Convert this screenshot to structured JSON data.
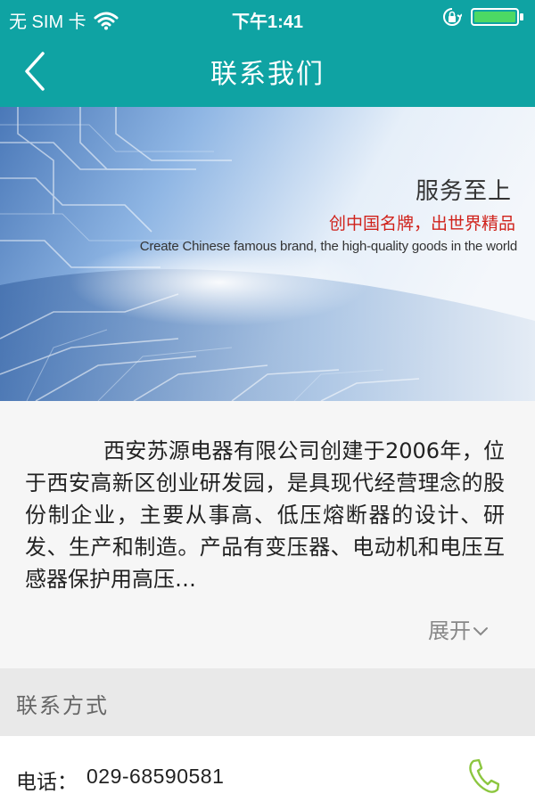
{
  "status_bar": {
    "carrier": "无 SIM 卡",
    "time": "下午1:41",
    "icons": [
      "wifi-icon",
      "orientation-lock-icon",
      "battery-icon"
    ]
  },
  "nav": {
    "back_icon": "chevron-left-icon",
    "title": "联系我们"
  },
  "banner": {
    "title": "服务至上",
    "slogan": "创中国名牌，出世界精品",
    "english": "Create Chinese famous brand, the high-quality goods in the world"
  },
  "intro": {
    "text": "西安苏源电器有限公司创建于2006年，位于西安高新区创业研发园，是具现代经营理念的股份制企业，主要从事高、低压熔断器的设计、研发、生产和制造。产品有变压器、电动机和电压互感器保护用高压…",
    "expand_label": "展开",
    "expand_icon": "chevron-down-icon"
  },
  "contact_section": {
    "title": "联系方式"
  },
  "contact": {
    "phone_label": "电话：",
    "phone_number": "029-68590581",
    "phone_icon": "phone-icon"
  },
  "colors": {
    "primary": "#0fa3a3",
    "slogan_red": "#d0221b",
    "phone_green": "#8cc63f",
    "battery_green": "#4cd964"
  }
}
